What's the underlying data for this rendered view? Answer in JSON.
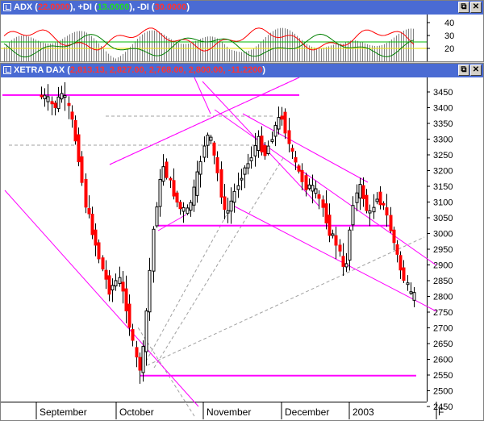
{
  "adx_pane": {
    "title_parts": [
      {
        "text": "ADX (",
        "color": "white"
      },
      {
        "text": "22.0000",
        "color": "red"
      },
      {
        "text": "), +DI (",
        "color": "white"
      },
      {
        "text": "13.0000",
        "color": "green"
      },
      {
        "text": "), -DI (",
        "color": "white"
      },
      {
        "text": "30.0000",
        "color": "red"
      },
      {
        "text": ")",
        "color": "white"
      }
    ],
    "axis_labels": [
      "40",
      "30",
      "20"
    ],
    "axis_values": [
      40,
      30,
      20
    ],
    "levels": [
      {
        "value": 25,
        "color": "#00bb00"
      },
      {
        "value": 20,
        "color": "#e8e000"
      }
    ],
    "ylim": [
      10,
      45
    ],
    "series_colors": {
      "adx": "#808080",
      "plus_di": "#008000",
      "minus_di": "#ff0000"
    }
  },
  "price_pane": {
    "title_parts": [
      {
        "text": "XETRA DAX (",
        "color": "white"
      },
      {
        "text": "2,813.13, 2,827.00, 2,768.00, 2,800.00, -11.2200",
        "color": "red"
      },
      {
        "text": ")",
        "color": "white"
      }
    ]
  },
  "window_buttons": {
    "restore": "⧉",
    "close": "✕"
  },
  "chart_data": {
    "type": "candlestick",
    "title": "XETRA DAX (2,813.13, 2,827.00, 2,768.00, 2,800.00, -11.2200)",
    "ylim": [
      2425,
      3510
    ],
    "yticks": [
      3450,
      3400,
      3350,
      3300,
      3250,
      3200,
      3150,
      3100,
      3050,
      3000,
      2950,
      2900,
      2850,
      2800,
      2750,
      2700,
      2650,
      2600,
      2550,
      2500,
      2450
    ],
    "xlabels": [
      "September",
      "October",
      "November",
      "December",
      "2003",
      "F"
    ],
    "last": {
      "open": 2813.13,
      "high": 2827.0,
      "low": 2768.0,
      "close": 2800.0,
      "change": -11.22
    },
    "horizontal_levels": [
      {
        "value": 3440,
        "color": "#ff00ff"
      },
      {
        "value": 3025,
        "color": "#ff00ff"
      },
      {
        "value": 2548,
        "color": "#ff00ff"
      }
    ],
    "up_color": "#000000",
    "down_color": "#ff0000",
    "annotation_color": "#ff00ff"
  }
}
